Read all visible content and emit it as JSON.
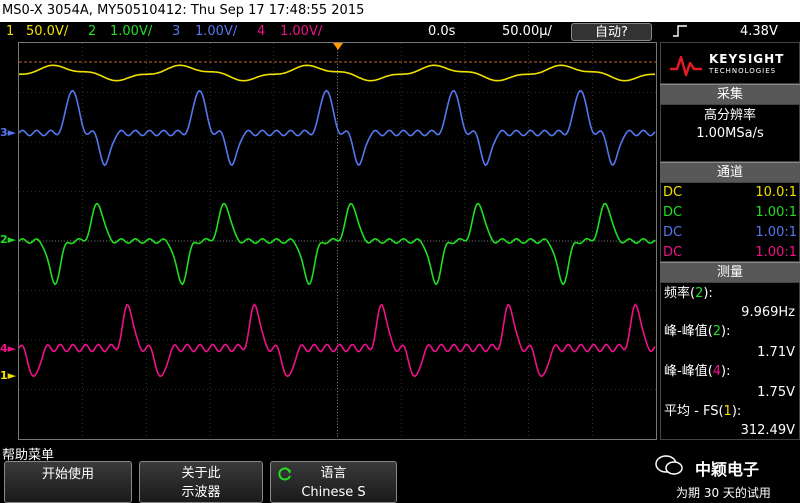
{
  "title": "MS0-X 3054A, MY50510412: Thu Sep 17 17:48:55 2015",
  "status": {
    "ch1_num": "1",
    "ch1_scale": "50.0V/",
    "ch2_num": "2",
    "ch2_scale": "1.00V/",
    "ch3_num": "3",
    "ch3_scale": "1.00V/",
    "ch4_num": "4",
    "ch4_scale": "1.00V/",
    "time_offset": "0.0s",
    "time_scale": "50.00µ/",
    "trigger_mode": "自动?",
    "trigger_icon": "rising-edge-icon",
    "trigger_level": "4.38V"
  },
  "logo": {
    "brand": "KEYSIGHT",
    "sub": "TECHNOLOGIES"
  },
  "acquire": {
    "header": "采集",
    "mode": "高分辨率",
    "rate": "1.00MSa/s"
  },
  "channels": {
    "header": "通道",
    "rows": [
      {
        "coupling": "DC",
        "ratio": "10.0:1"
      },
      {
        "coupling": "DC",
        "ratio": "1.00:1"
      },
      {
        "coupling": "DC",
        "ratio": "1.00:1"
      },
      {
        "coupling": "DC",
        "ratio": "1.00:1"
      }
    ]
  },
  "measure": {
    "header": "测量",
    "items": [
      {
        "label_pre": "频率(",
        "num": "2",
        "label_post": "):",
        "value": "9.969Hz"
      },
      {
        "label_pre": "峰-峰值(",
        "num": "2",
        "label_post": "):",
        "value": "1.71V"
      },
      {
        "label_pre": "峰-峰值(",
        "num": "4",
        "label_post": "):",
        "value": "1.75V"
      },
      {
        "label_pre": "平均 - FS(",
        "num": "1",
        "label_post": "):",
        "value": "312.49V"
      }
    ]
  },
  "menu_label": "帮助菜单",
  "softkeys": {
    "k1_l1": "开始使用",
    "k2_l1": "关于此",
    "k2_l2": "示波器",
    "k3_l1": "语言",
    "k3_l2": "Chinese S"
  },
  "watermark": {
    "name": "中颖电子",
    "trial": "为期 30 天的试用"
  },
  "channel_markers": {
    "m1": "1",
    "m2": "2",
    "m3": "3",
    "m4": "4"
  },
  "colors": {
    "ch1": "#f0e000",
    "ch2": "#22dd22",
    "ch3": "#5577ee",
    "ch4": "#ee1188",
    "grid": "#555555",
    "panel_header": "#585858"
  }
}
